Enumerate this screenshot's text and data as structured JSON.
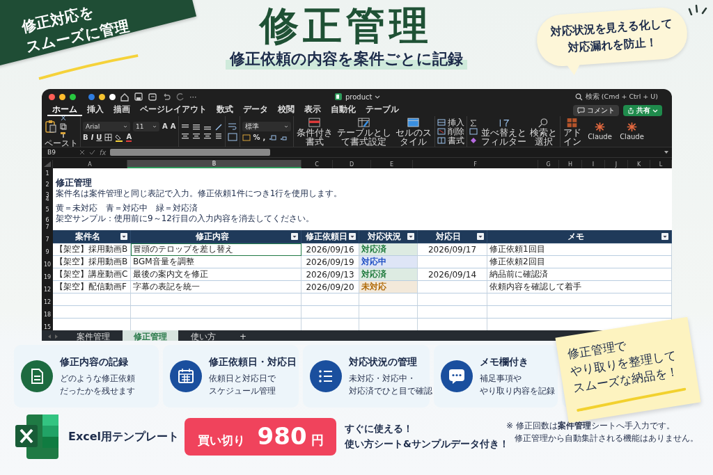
{
  "banner": {
    "lines": [
      "修正対応を",
      "スムーズに管理"
    ]
  },
  "title": "修正管理",
  "subtitle": "修正依頼の内容を案件ごとに記録",
  "bubble": {
    "lines": [
      "対応状況を見える化して",
      "対応漏れを防止！"
    ]
  },
  "window": {
    "more": "···",
    "file_name": "product",
    "search": "検索 (Cmd + Ctrl + U)",
    "comment_button": "コメント",
    "share_button": "共有"
  },
  "menu_tabs": [
    {
      "label": "ホーム",
      "selected": true
    },
    {
      "label": "挿入",
      "selected": false
    },
    {
      "label": "描画",
      "selected": false
    },
    {
      "label": "ページレイアウト",
      "selected": false
    },
    {
      "label": "数式",
      "selected": false
    },
    {
      "label": "データ",
      "selected": false
    },
    {
      "label": "校閲",
      "selected": false
    },
    {
      "label": "表示",
      "selected": false
    },
    {
      "label": "自動化",
      "selected": false
    },
    {
      "label": "テーブル",
      "selected": false
    }
  ],
  "ribbon": {
    "paste": "ペースト",
    "font": "Arial",
    "font_size": "11",
    "grow_font": "A",
    "shrink_font": "A",
    "format_buttons": [
      "B",
      "I",
      "U"
    ],
    "font_color": "A",
    "number_format": "標準",
    "percent": "%",
    "comma": ",",
    "large_commands": [
      {
        "label": "条件付き書式",
        "kind": "conditional"
      },
      {
        "label": "テーブルとして書式設定",
        "kind": "table"
      },
      {
        "label": "セルのスタイル",
        "kind": "styles"
      }
    ],
    "cell_commands": [
      "挿入",
      "削除",
      "書式"
    ],
    "editing_commands": [
      {
        "label": "並べ替えとフィルター",
        "kind": "sort"
      },
      {
        "label": "検索と選択",
        "kind": "find"
      }
    ],
    "addin_commands": [
      {
        "label": "アドイン",
        "kind": "addin"
      },
      {
        "label": "Claude",
        "kind": "claude"
      },
      {
        "label": "Claude",
        "kind": "claude"
      }
    ]
  },
  "cell_ref": "B9",
  "formula_label": "fx",
  "columns": [
    {
      "label": "A",
      "selected": false
    },
    {
      "label": "B",
      "selected": true
    },
    {
      "label": "C",
      "selected": false
    },
    {
      "label": "D",
      "selected": false
    },
    {
      "label": "E",
      "selected": false
    },
    {
      "label": "F",
      "selected": false
    },
    {
      "label": "G",
      "selected": false
    },
    {
      "label": "H",
      "selected": false
    },
    {
      "label": "I",
      "selected": false
    },
    {
      "label": "J",
      "selected": false
    },
    {
      "label": "K",
      "selected": false
    },
    {
      "label": "L",
      "selected": false
    }
  ],
  "intro_rows": [
    {
      "number": "1",
      "kind": "blank"
    },
    {
      "number": "2",
      "kind": "heading",
      "text": "修正管理"
    },
    {
      "number": "3",
      "kind": "note",
      "text": "案件名は案件管理と同じ表記で入力。修正依頼1件につき1行を使用します。"
    },
    {
      "number": "4",
      "kind": "gap"
    },
    {
      "number": "5",
      "kind": "note",
      "text": "黄＝未対応　青＝対応中　緑＝対応済"
    },
    {
      "number": "6",
      "kind": "note",
      "text": "架空サンプル：使用前に9～12行目の入力内容を消去してください。"
    },
    {
      "number": "7",
      "kind": "spacer"
    }
  ],
  "table": {
    "header_number": "7",
    "headers": [
      "案件名",
      "修正内容",
      "修正依頼日",
      "対応状況",
      "対応日",
      "メモ"
    ],
    "rows": [
      {
        "number": "9",
        "project": "【架空】採用動画B",
        "content": "冒頭のテロップを差し替え",
        "requested": "2026/09/16",
        "status": "対応済",
        "color": "#1e7a3c",
        "done_date": "2026/09/17",
        "memo": "修正依頼1回目",
        "selected": true
      },
      {
        "number": "10",
        "project": "【架空】採用動画B",
        "content": "BGM音量を調整",
        "requested": "2026/09/19",
        "status": "対応中",
        "color": "#1f4fc4",
        "memo": "修正依頼2回目",
        "selected": false
      },
      {
        "number": "19",
        "project": "【架空】講座動画C",
        "content": "最後の案内文を修正",
        "requested": "2026/09/13",
        "status": "対応済",
        "color": "#1e7a3c",
        "done_date": "2026/09/14",
        "memo": "納品前に確認済",
        "selected": false
      },
      {
        "number": "12",
        "project": "【架空】配信動画F",
        "content": "字幕の表記を統一",
        "requested": "2026/09/20",
        "status": "未対応",
        "color": "#b06a08",
        "memo": "依頼内容を確認して着手",
        "selected": false
      }
    ],
    "empty_rows": [
      {
        "number": "12"
      },
      {
        "number": "18"
      },
      {
        "number": "15"
      }
    ]
  },
  "sheet_tabs": [
    {
      "label": "案件管理",
      "selected": false
    },
    {
      "label": "修正管理",
      "selected": true
    },
    {
      "label": "使い方",
      "selected": false
    }
  ],
  "add_sheet": "+",
  "features": [
    {
      "title": "修正内容の記録",
      "lines": [
        "どのような修正依頼",
        "だったかを残せます"
      ],
      "kind": "document",
      "color": "#1d6b40"
    },
    {
      "title": "修正依頼日・対応日",
      "lines": [
        "依頼日と対応日で",
        "スケジュール管理"
      ],
      "kind": "calendar",
      "color": "#1a4f9e"
    },
    {
      "title": "対応状況の管理",
      "lines": [
        "未対応・対応中・",
        "対応済でひと目で確認"
      ],
      "kind": "list",
      "color": "#1a4f9e"
    },
    {
      "title": "メモ欄付き",
      "lines": [
        "補足事項や",
        "やり取り内容を記録"
      ],
      "kind": "chat",
      "color": "#1a4f9e"
    }
  ],
  "sticky_note": {
    "lines": [
      "修正管理で",
      "やり取りを整理して",
      "スムーズな納品を！"
    ]
  },
  "product": {
    "label": "Excel用テンプレート",
    "price_label": "買い切り",
    "price": "980",
    "price_unit": "円",
    "promo": [
      "すぐに使える！",
      "使い方シート&サンプルデータ付き！"
    ],
    "note": [
      "※ 修正回数は**案件管理**シートへ手入力です。",
      "修正管理から自動集計される機能はありません。"
    ]
  }
}
